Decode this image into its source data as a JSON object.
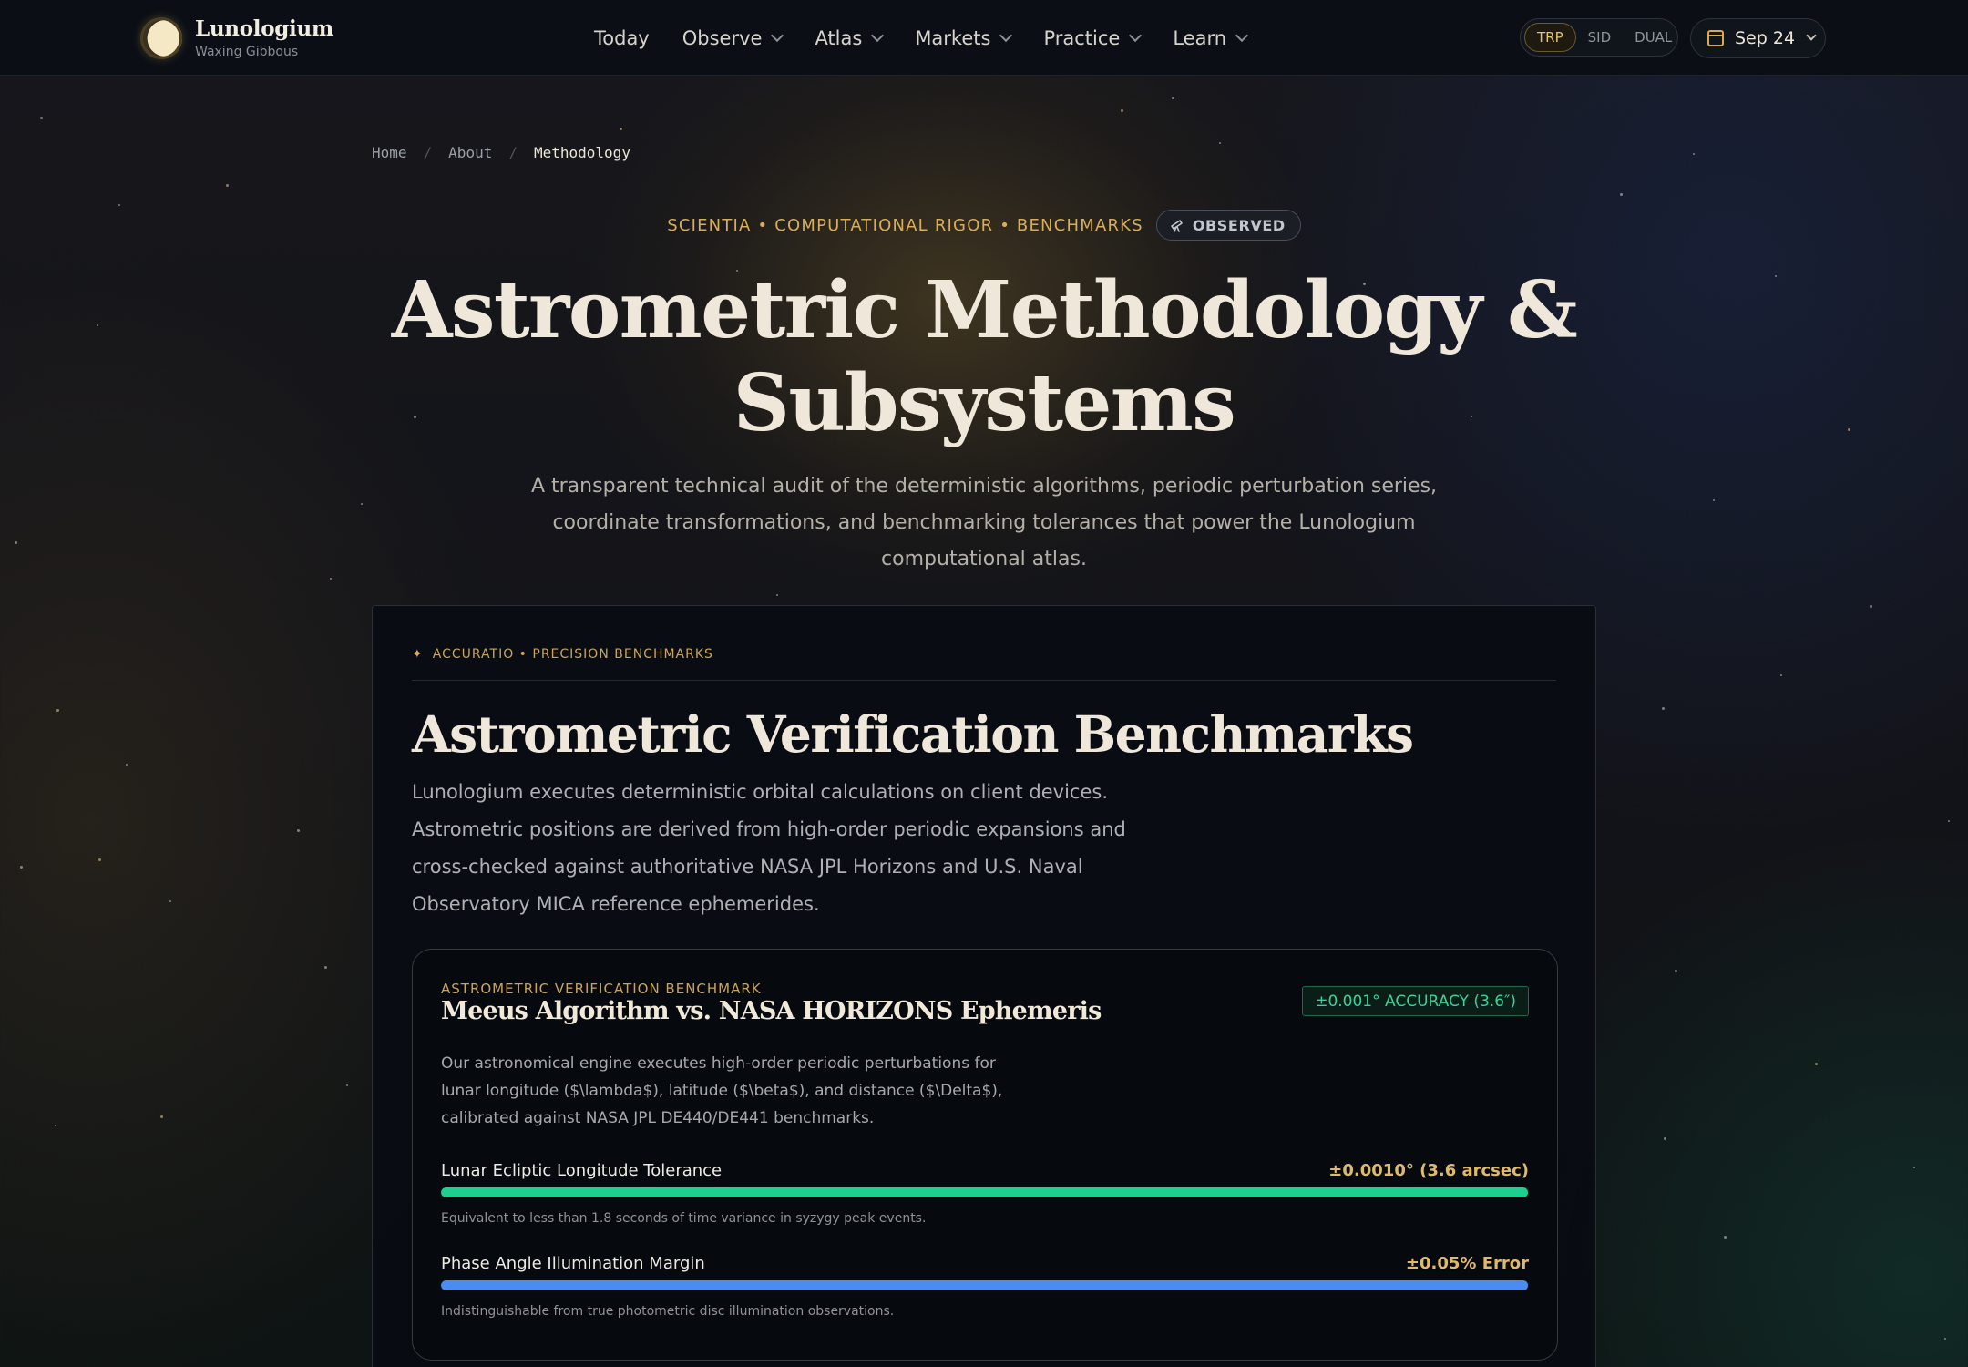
{
  "nav": {
    "brand_name": "Lunologium",
    "brand_sub": "Waxing Gibbous",
    "menu": [
      {
        "label": "Today",
        "dropdown": false
      },
      {
        "label": "Observe",
        "dropdown": true
      },
      {
        "label": "Atlas",
        "dropdown": true
      },
      {
        "label": "Markets",
        "dropdown": true
      },
      {
        "label": "Practice",
        "dropdown": true
      },
      {
        "label": "Learn",
        "dropdown": true
      }
    ],
    "modes": [
      "TRP",
      "SID",
      "DUAL"
    ],
    "active_mode": "TRP",
    "date_label": "Sep 24"
  },
  "breadcrumb": [
    "Home",
    "About",
    "Methodology"
  ],
  "hero": {
    "eyebrow": "SCIENTIA • COMPUTATIONAL RIGOR • BENCHMARKS",
    "badge": "OBSERVED",
    "title_line1": "Astrometric Methodology &",
    "title_line2": "Subsystems",
    "subtitle": "A transparent technical audit of the deterministic algorithms, periodic perturbation series, coordinate transformations, and benchmarking tolerances that power the Lunologium computational atlas."
  },
  "section": {
    "eyebrow": "ACCURATIO • PRECISION BENCHMARKS",
    "title": "Astrometric Verification Benchmarks",
    "description": "Lunologium executes deterministic orbital calculations on client devices. Astrometric positions are derived from high-order periodic expansions and cross-checked against authoritative NASA JPL Horizons and U.S. Naval Observatory MICA reference ephemerides."
  },
  "card": {
    "eyebrow": "ASTROMETRIC VERIFICATION BENCHMARK",
    "title": "Meeus Algorithm vs. NASA HORIZONS Ephemeris",
    "badge": "±0.001° ACCURACY (3.6″)",
    "description": "Our astronomical engine executes high-order periodic perturbations for lunar longitude ($\\lambda$), latitude ($\\beta$), and distance ($\\Delta$), calibrated against NASA JPL DE440/DE441 benchmarks.",
    "metrics": [
      {
        "label": "Lunar Ecliptic Longitude Tolerance",
        "value": "±0.0010° (3.6 arcsec)",
        "fill_fraction": 0.999,
        "color": "#1fcf8e",
        "note": "Equivalent to less than 1.8 seconds of time variance in syzygy peak events."
      },
      {
        "label": "Phase Angle Illumination Margin",
        "value": "±0.05% Error",
        "fill_fraction": 0.9995,
        "color": "#4b8cf0",
        "note": "Indistinguishable from true photometric disc illumination observations."
      }
    ]
  },
  "colors": {
    "accent_gold": "#d6ae5c",
    "accent_green": "#36d39a",
    "accent_blue": "#4b8cf0"
  }
}
